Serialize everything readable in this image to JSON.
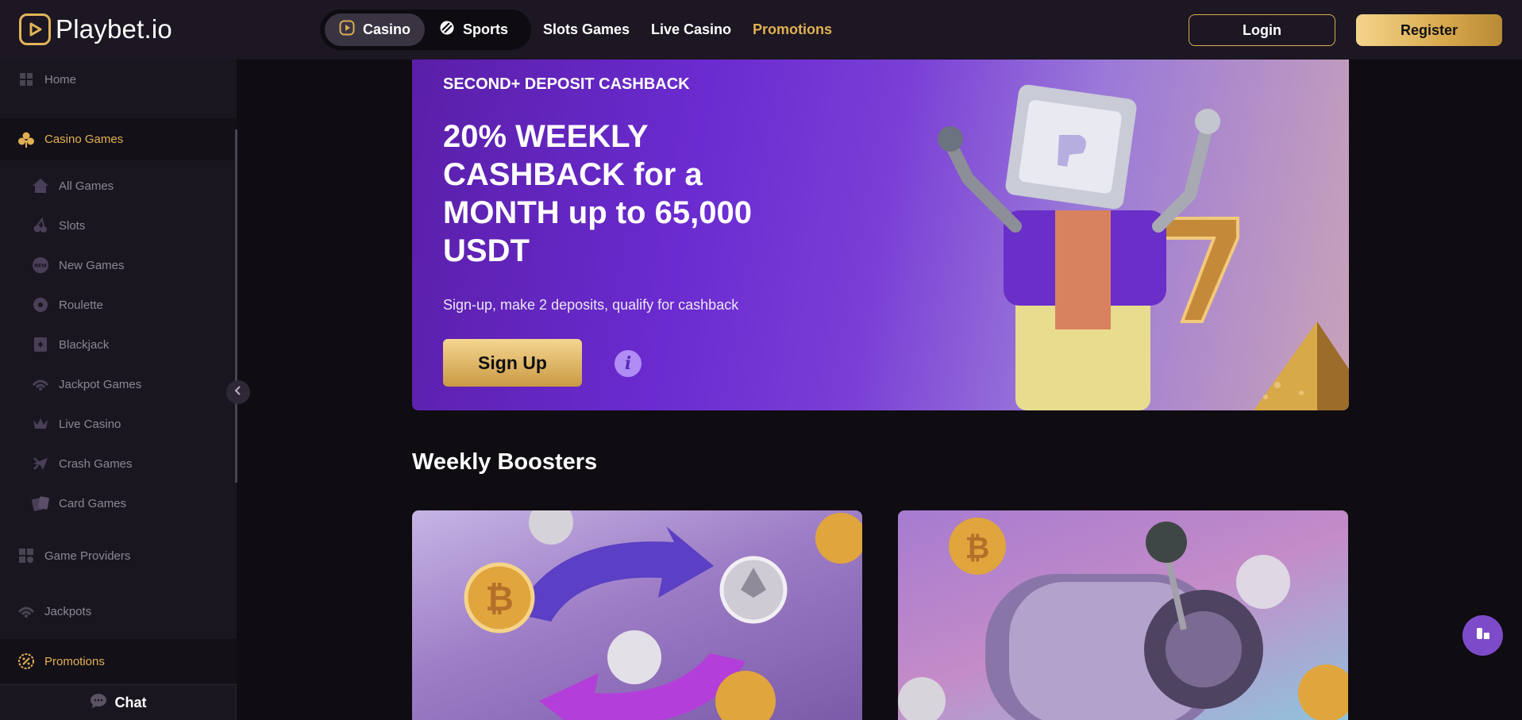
{
  "header": {
    "logo_text": "Playbet.io",
    "modes": [
      {
        "label": "Casino",
        "icon": "play-icon",
        "active": true
      },
      {
        "label": "Sports",
        "icon": "ball-icon",
        "active": false
      }
    ],
    "nav": [
      "Slots Games",
      "Live Casino",
      "Promotions"
    ],
    "login_label": "Login",
    "register_label": "Register"
  },
  "sidebar": {
    "home": "Home",
    "casino_games": "Casino Games",
    "sub_items": [
      "All Games",
      "Slots",
      "New Games",
      "Roulette",
      "Blackjack",
      "Jackpot Games",
      "Live Casino",
      "Crash Games",
      "Card Games"
    ],
    "game_providers": "Game Providers",
    "jackpots": "Jackpots",
    "promotions": "Promotions",
    "chat_label": "Chat"
  },
  "hero": {
    "kicker": "SECOND+ DEPOSIT CASHBACK",
    "title": "20% WEEKLY CASHBACK for a MONTH up to 65,000 USDT",
    "subtitle": "Sign-up, make 2 deposits, qualify for cashback",
    "cta_label": "Sign Up",
    "info_glyph": "i"
  },
  "section": {
    "title": "Weekly Boosters"
  },
  "colors": {
    "accent_gold": "#e1b052",
    "hero_purple": "#6a2bd0",
    "background": "#0f0c12"
  }
}
